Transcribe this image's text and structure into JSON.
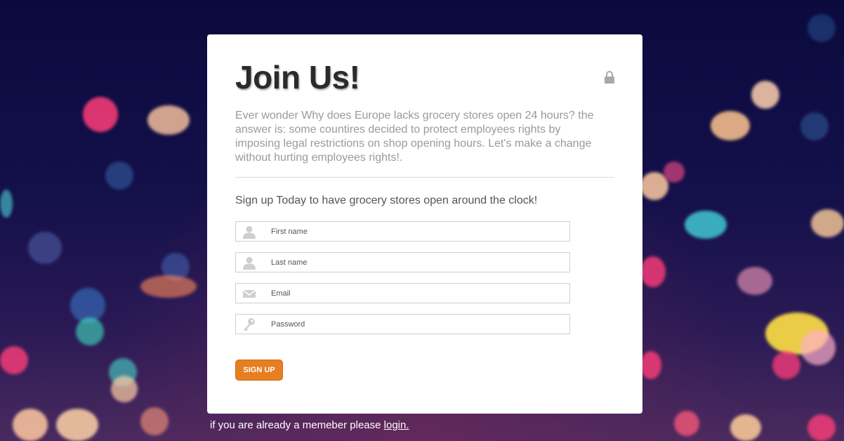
{
  "card": {
    "title": "Join Us!",
    "intro": "Ever wonder Why does Europe lacks grocery stores open 24 hours? the answer is: some countires decided to protect employees rights by imposing legal restrictions on shop opening hours. Let's make a change without hurting employees rights!.",
    "subheading": "Sign up Today to have grocery stores open around the clock!",
    "lock_icon": "lock-icon"
  },
  "form": {
    "first_name_placeholder": "First name",
    "last_name_placeholder": "Last name",
    "email_placeholder": "Email",
    "password_placeholder": "Password",
    "submit_label": "SIGN UP"
  },
  "footer": {
    "text": "if you are already a memeber please ",
    "login_link": "login."
  },
  "colors": {
    "accent": "#e67e22",
    "background": "#0e0b3a",
    "card": "#ffffff"
  }
}
